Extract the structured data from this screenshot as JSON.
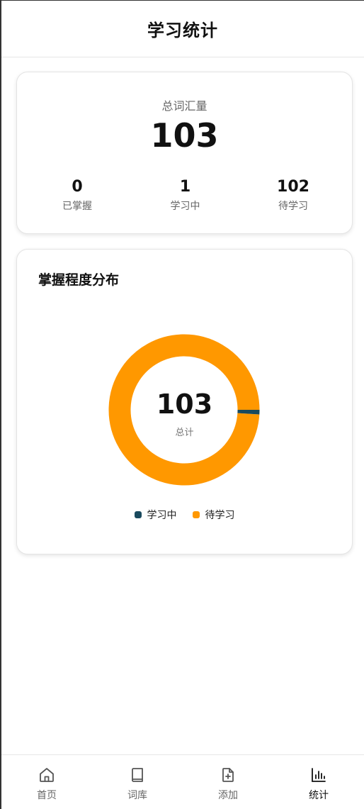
{
  "header": {
    "title": "学习统计"
  },
  "summary": {
    "label": "总词汇量",
    "total": "103",
    "stats": [
      {
        "value": "0",
        "label": "已掌握"
      },
      {
        "value": "1",
        "label": "学习中"
      },
      {
        "value": "102",
        "label": "待学习"
      }
    ]
  },
  "distribution": {
    "title": "掌握程度分布",
    "center_total": "103",
    "center_label": "总计"
  },
  "chart_data": {
    "type": "pie",
    "categories": [
      "学习中",
      "待学习"
    ],
    "values": [
      1,
      102
    ],
    "colors": [
      "#1a4a5e",
      "#ff9800"
    ],
    "donut": true,
    "legend": "bottom"
  },
  "tabbar": {
    "items": [
      {
        "label": "首页",
        "icon": "home-icon"
      },
      {
        "label": "词库",
        "icon": "book-icon"
      },
      {
        "label": "添加",
        "icon": "file-plus-icon"
      },
      {
        "label": "统计",
        "icon": "bar-chart-icon"
      }
    ],
    "active_index": 3
  }
}
